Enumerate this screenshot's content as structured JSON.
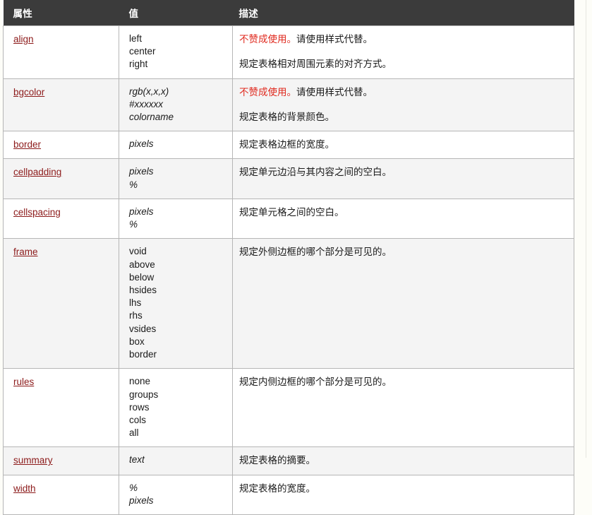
{
  "table": {
    "headers": {
      "attribute": "属性",
      "value": "值",
      "description": "描述"
    },
    "colors": {
      "header_bg": "#3b3b3b",
      "header_text": "#ffffff",
      "link": "#8c1a1a",
      "deprecated_red": "#e02b20",
      "row_alt_bg": "#f4f4f4",
      "row_bg": "#ffffff",
      "border": "#b6b6b6",
      "page_bg": "#fdfdf8"
    },
    "rows": [
      {
        "attribute": "align",
        "values": [
          "left",
          "center",
          "right"
        ],
        "values_italic": false,
        "deprecated_label": "不赞成使用。",
        "deprecated_rest": "请使用样式代替。",
        "description": "规定表格相对周围元素的对齐方式。"
      },
      {
        "attribute": "bgcolor",
        "values": [
          "rgb(x,x,x)",
          "#xxxxxx",
          "colorname"
        ],
        "values_italic": true,
        "deprecated_label": "不赞成使用。",
        "deprecated_rest": "请使用样式代替。",
        "description": "规定表格的背景颜色。"
      },
      {
        "attribute": "border",
        "values": [
          "pixels"
        ],
        "values_italic": true,
        "deprecated_label": "",
        "deprecated_rest": "",
        "description": "规定表格边框的宽度。"
      },
      {
        "attribute": "cellpadding",
        "values": [
          "pixels",
          "%"
        ],
        "values_italic": true,
        "deprecated_label": "",
        "deprecated_rest": "",
        "description": "规定单元边沿与其内容之间的空白。"
      },
      {
        "attribute": "cellspacing",
        "values": [
          "pixels",
          "%"
        ],
        "values_italic": true,
        "deprecated_label": "",
        "deprecated_rest": "",
        "description": "规定单元格之间的空白。"
      },
      {
        "attribute": "frame",
        "values": [
          "void",
          "above",
          "below",
          "hsides",
          "lhs",
          "rhs",
          "vsides",
          "box",
          "border"
        ],
        "values_italic": false,
        "deprecated_label": "",
        "deprecated_rest": "",
        "description": "规定外侧边框的哪个部分是可见的。"
      },
      {
        "attribute": "rules",
        "values": [
          "none",
          "groups",
          "rows",
          "cols",
          "all"
        ],
        "values_italic": false,
        "deprecated_label": "",
        "deprecated_rest": "",
        "description": "规定内侧边框的哪个部分是可见的。"
      },
      {
        "attribute": "summary",
        "values": [
          "text"
        ],
        "values_italic": true,
        "deprecated_label": "",
        "deprecated_rest": "",
        "description": "规定表格的摘要。"
      },
      {
        "attribute": "width",
        "values": [
          "%",
          "pixels"
        ],
        "values_italic": true,
        "deprecated_label": "",
        "deprecated_rest": "",
        "description": "规定表格的宽度。"
      }
    ]
  }
}
